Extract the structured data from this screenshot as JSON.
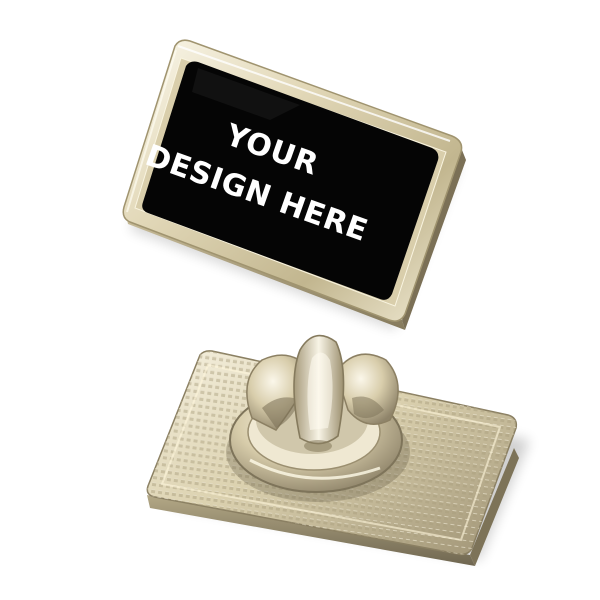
{
  "product": {
    "front_text_line1": "YOUR",
    "front_text_line2": "DESIGN HERE",
    "colors": {
      "background": "#ffffff",
      "enamel_fill": "#050505",
      "metal_light": "#f4efdd",
      "metal_mid": "#cfc4a2",
      "metal_dark": "#8c8063",
      "text": "#ffffff"
    }
  }
}
